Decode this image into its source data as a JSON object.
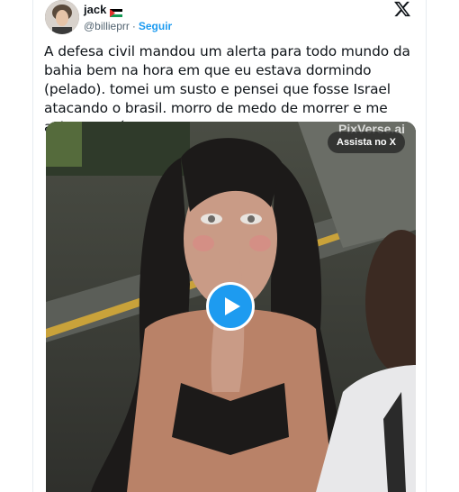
{
  "tweet": {
    "display_name": "jack",
    "handle": "@billieprr",
    "separator": "·",
    "follow_label": "Seguir",
    "text": "A defesa civil mandou um alerta para todo mundo da bahia bem na hora em que eu estava dormindo (pelado). tomei um susto e pensei que fosse Israel atacando o brasil. morro de medo de morrer e me acharem nú"
  },
  "media": {
    "watermark": "PixVerse.ai",
    "watch_label": "Assista no X"
  },
  "icons": {
    "brand": "x-logo-icon",
    "flag": "palestine-flag-icon",
    "play": "play-icon"
  },
  "colors": {
    "accent": "#1d9bf0",
    "text": "#0f1419",
    "muted": "#536471"
  }
}
